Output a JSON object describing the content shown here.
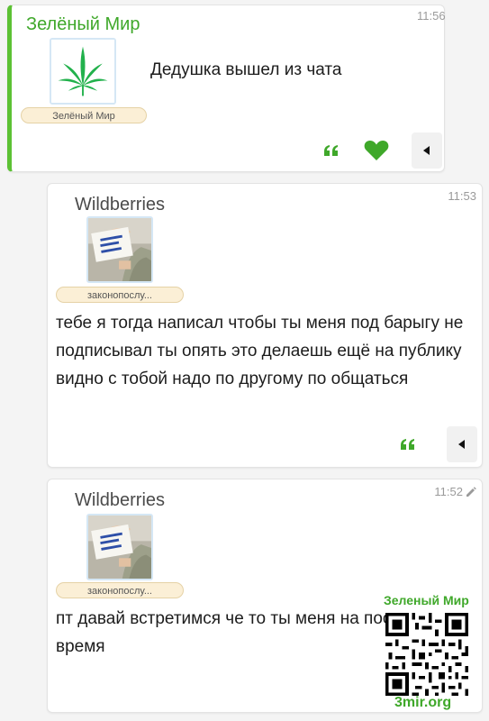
{
  "messages": [
    {
      "author": "Зелёный Мир",
      "time": "11:56",
      "avatar_label": "Зелёный Мир",
      "text": "Дедушка вышел из чата",
      "actions": [
        "quote-icon",
        "heart-icon",
        "menu-arrow-icon"
      ]
    },
    {
      "author": "Wildberries",
      "time": "11:53",
      "avatar_label": "законопослу...",
      "text": "тебе я тогда написал чтобы ты меня под барыгу не подписывал ты опять это делаешь ещё на публику видно с тобой надо по другому по общаться",
      "actions": [
        "quote-icon",
        "menu-arrow-icon"
      ]
    },
    {
      "author": "Wildberries",
      "time": "11:52",
      "edited_icon": "pencil-icon",
      "avatar_label": "законопослу...",
      "text": "пт давай встретимся че то ты меня на последние время"
    }
  ],
  "watermark": {
    "title": "Зеленый Мир",
    "site": "3mir.org",
    "icon": "qr-code-icon"
  },
  "colors": {
    "accent": "#3fa82a",
    "leaf": "#22b14c",
    "pill_bg": "#fbefd6",
    "card_bg": "#ffffff"
  }
}
